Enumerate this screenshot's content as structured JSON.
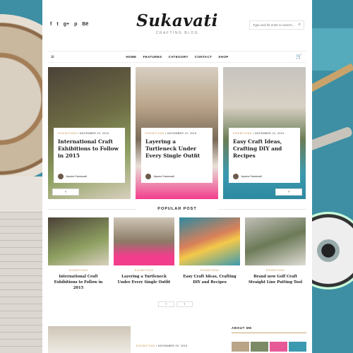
{
  "header": {
    "logo": "Sukavati",
    "tagline": "CRAFTING BLOG",
    "social": [
      "f",
      "t",
      "g+",
      "p",
      "Bē"
    ],
    "search_placeholder": "Type and hit enter to search..."
  },
  "nav": {
    "items": [
      "HOME",
      "FEATURES",
      "CATEGORY",
      "CONTACT",
      "SHOP"
    ]
  },
  "slider": {
    "slides": [
      {
        "category": "EXHIBITIONS",
        "date": "NOVEMBER 20, 2015",
        "title": "International Craft Exhibitions to Follow in 2015",
        "author": "Jayana Saraswati"
      },
      {
        "category": "EXHIBITIONS",
        "date": "NOVEMBER 10, 2015",
        "title": "Layering a Turtleneck Under Every Single Outfit",
        "author": "Jayana Saraswati"
      },
      {
        "category": "EXHIBITIONS",
        "date": "NOVEMBER 10, 2015",
        "title": "Easy Craft Ideas, Crafting DIY and Recipes",
        "author": "Jayana Saraswati"
      }
    ],
    "prev": "‹",
    "next": "›"
  },
  "popular": {
    "heading": "POPULAR POST",
    "posts": [
      {
        "category": "EXHIBITIONS",
        "title": "International Craft Exhibitions to Follow in 2015"
      },
      {
        "category": "EXHIBITIONS",
        "title": "Layering a Turtleneck Under Every Single Outfit"
      },
      {
        "category": "EXHIBITIONS",
        "title": "Easy Craft Ideas, Crafting DIY and Recipes"
      },
      {
        "category": "EXHIBITIONS",
        "title": "Brand new Golf Craft Straight Line Putting Tool"
      }
    ],
    "prev": "‹",
    "next": "›"
  },
  "bottom": {
    "category": "EXHIBITIONS",
    "date": "NOVEMBER 20, 2015"
  },
  "sidebar": {
    "about_heading": "ABOUT ME"
  },
  "colors": {
    "accent": "#c48f4b",
    "text": "#1e1e1e"
  }
}
